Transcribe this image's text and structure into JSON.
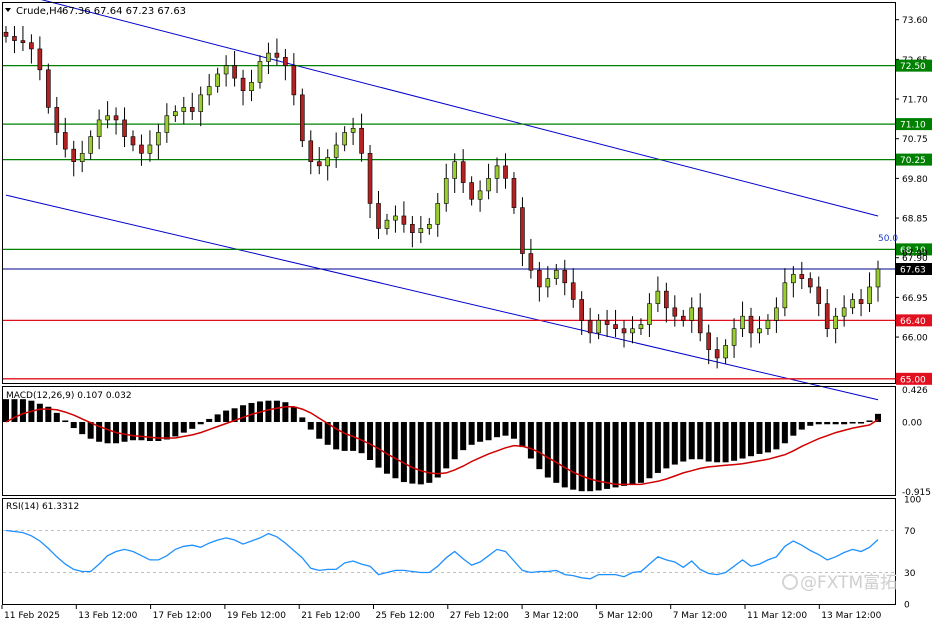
{
  "header": {
    "symbol": "Crude,H4",
    "ohlc": "67.36 67.64 67.23 67.63"
  },
  "watermark": "@FXTM富拓",
  "colors": {
    "bull": "#9acd32",
    "bear": "#b22222",
    "support": "#e0101e",
    "resistance": "#008000",
    "channel": "#0000cd",
    "current": "#00008b",
    "macd_signal": "#d00000",
    "rsi_line": "#1e90ff"
  },
  "chart_data": [
    {
      "type": "candlestick",
      "title": "Crude,H4",
      "ylim": [
        64.9,
        74.0
      ],
      "y_ticks": [
        "73.60",
        "72.65",
        "71.70",
        "70.75",
        "69.80",
        "68.85",
        "67.90",
        "66.95",
        "66.00"
      ],
      "x_ticks": [
        "11 Feb 2025",
        "13 Feb 12:00",
        "17 Feb 12:00",
        "19 Feb 12:00",
        "21 Feb 12:00",
        "25 Feb 12:00",
        "27 Feb 12:00",
        "3 Mar 12:00",
        "5 Mar 12:00",
        "7 Mar 12:00",
        "11 Mar 12:00",
        "13 Mar 12:00"
      ],
      "close": [
        73.2,
        73.1,
        73.05,
        72.9,
        72.4,
        71.5,
        70.9,
        70.5,
        70.2,
        70.4,
        70.8,
        71.2,
        71.3,
        71.2,
        70.8,
        70.6,
        70.4,
        70.6,
        70.9,
        71.3,
        71.4,
        71.5,
        71.4,
        71.8,
        72.0,
        72.3,
        72.5,
        72.2,
        71.9,
        72.1,
        72.6,
        72.8,
        72.7,
        72.5,
        71.8,
        70.7,
        70.2,
        70.1,
        70.3,
        70.6,
        70.9,
        71.0,
        70.4,
        69.2,
        68.6,
        68.8,
        68.9,
        68.7,
        68.5,
        68.6,
        68.7,
        69.2,
        69.8,
        70.2,
        69.7,
        69.3,
        69.5,
        69.8,
        70.1,
        69.8,
        69.1,
        68.0,
        67.6,
        67.2,
        67.4,
        67.6,
        67.3,
        66.9,
        66.4,
        66.1,
        66.4,
        66.3,
        66.2,
        66.1,
        66.2,
        66.3,
        66.8,
        67.1,
        66.7,
        66.5,
        66.4,
        66.7,
        66.1,
        65.7,
        65.5,
        65.8,
        66.2,
        66.5,
        66.1,
        66.2,
        66.4,
        66.7,
        67.3,
        67.5,
        67.4,
        67.2,
        66.8,
        66.2,
        66.5,
        66.7,
        66.9,
        66.8,
        67.2,
        67.63
      ],
      "levels": [
        {
          "value": "72.50",
          "kind": "resistance"
        },
        {
          "value": "71.10",
          "kind": "resistance"
        },
        {
          "value": "70.25",
          "kind": "resistance"
        },
        {
          "value": "68.10",
          "kind": "resistance"
        },
        {
          "value": "66.40",
          "kind": "support"
        },
        {
          "value": "65.00",
          "kind": "support"
        }
      ],
      "current_price": "67.63",
      "fib_label": "50.0",
      "fib_value": "67.90",
      "channel_upper": [
        [
          0,
          74.3
        ],
        [
          103,
          68.9
        ]
      ],
      "channel_lower": [
        [
          0,
          69.4
        ],
        [
          103,
          64.5
        ]
      ]
    },
    {
      "type": "bar",
      "title": "MACD(12,26,9) 0.107 0.032",
      "ylim": [
        -0.96,
        0.46
      ],
      "y_ticks": [
        "0.426",
        "0.00",
        "-0.915"
      ],
      "series": [
        {
          "name": "MACD",
          "values": [
            0.3,
            0.3,
            0.3,
            0.28,
            0.24,
            0.2,
            0.12,
            0.02,
            -0.08,
            -0.16,
            -0.22,
            -0.26,
            -0.28,
            -0.28,
            -0.26,
            -0.24,
            -0.24,
            -0.25,
            -0.25,
            -0.23,
            -0.19,
            -0.14,
            -0.09,
            -0.03,
            0.04,
            0.1,
            0.15,
            0.18,
            0.22,
            0.25,
            0.27,
            0.28,
            0.28,
            0.26,
            0.2,
            0.06,
            -0.1,
            -0.22,
            -0.3,
            -0.36,
            -0.38,
            -0.38,
            -0.41,
            -0.5,
            -0.6,
            -0.68,
            -0.74,
            -0.79,
            -0.81,
            -0.82,
            -0.8,
            -0.73,
            -0.61,
            -0.49,
            -0.37,
            -0.3,
            -0.26,
            -0.24,
            -0.2,
            -0.18,
            -0.22,
            -0.33,
            -0.48,
            -0.62,
            -0.73,
            -0.8,
            -0.86,
            -0.89,
            -0.91,
            -0.91,
            -0.9,
            -0.88,
            -0.86,
            -0.84,
            -0.82,
            -0.8,
            -0.74,
            -0.67,
            -0.61,
            -0.56,
            -0.52,
            -0.49,
            -0.49,
            -0.52,
            -0.53,
            -0.53,
            -0.51,
            -0.48,
            -0.45,
            -0.42,
            -0.4,
            -0.36,
            -0.28,
            -0.18,
            -0.1,
            -0.05,
            -0.03,
            -0.03,
            -0.03,
            -0.03,
            -0.02,
            -0.02,
            0.02,
            0.107
          ]
        },
        {
          "name": "Signal",
          "values": [
            0.0,
            0.06,
            0.11,
            0.14,
            0.17,
            0.17,
            0.16,
            0.13,
            0.09,
            0.04,
            -0.01,
            -0.06,
            -0.1,
            -0.14,
            -0.16,
            -0.18,
            -0.19,
            -0.2,
            -0.21,
            -0.21,
            -0.21,
            -0.19,
            -0.17,
            -0.14,
            -0.1,
            -0.06,
            -0.02,
            0.02,
            0.06,
            0.1,
            0.13,
            0.16,
            0.18,
            0.2,
            0.2,
            0.17,
            0.12,
            0.05,
            -0.02,
            -0.09,
            -0.15,
            -0.19,
            -0.24,
            -0.29,
            -0.35,
            -0.42,
            -0.48,
            -0.54,
            -0.6,
            -0.64,
            -0.67,
            -0.68,
            -0.67,
            -0.63,
            -0.58,
            -0.52,
            -0.47,
            -0.42,
            -0.38,
            -0.34,
            -0.31,
            -0.32,
            -0.35,
            -0.4,
            -0.47,
            -0.53,
            -0.6,
            -0.66,
            -0.71,
            -0.75,
            -0.78,
            -0.8,
            -0.82,
            -0.82,
            -0.82,
            -0.82,
            -0.8,
            -0.78,
            -0.75,
            -0.71,
            -0.67,
            -0.64,
            -0.61,
            -0.59,
            -0.58,
            -0.57,
            -0.56,
            -0.55,
            -0.53,
            -0.51,
            -0.49,
            -0.46,
            -0.43,
            -0.38,
            -0.32,
            -0.27,
            -0.22,
            -0.18,
            -0.14,
            -0.11,
            -0.08,
            -0.06,
            -0.04,
            0.032
          ]
        }
      ]
    },
    {
      "type": "line",
      "title": "RSI(14) 61.3312",
      "ylim": [
        0,
        100
      ],
      "y_ticks": [
        "100",
        "70",
        "30",
        "0"
      ],
      "series": [
        {
          "name": "RSI(14)",
          "values": [
            70,
            69,
            68,
            65,
            60,
            53,
            45,
            38,
            33,
            31,
            31,
            38,
            46,
            50,
            52,
            50,
            46,
            42,
            42,
            46,
            52,
            55,
            56,
            54,
            58,
            61,
            63,
            61,
            57,
            60,
            63,
            67,
            64,
            58,
            51,
            44,
            34,
            32,
            33,
            33,
            39,
            41,
            38,
            36,
            28,
            30,
            32,
            32,
            31,
            30,
            30,
            36,
            44,
            50,
            43,
            37,
            40,
            46,
            52,
            50,
            41,
            32,
            30,
            31,
            31,
            32,
            28,
            27,
            25,
            24,
            28,
            28,
            28,
            26,
            30,
            31,
            38,
            45,
            42,
            40,
            35,
            41,
            33,
            29,
            28,
            30,
            36,
            42,
            36,
            38,
            42,
            45,
            55,
            60,
            56,
            51,
            47,
            42,
            45,
            49,
            52,
            50,
            54,
            61.3312
          ]
        }
      ]
    }
  ]
}
